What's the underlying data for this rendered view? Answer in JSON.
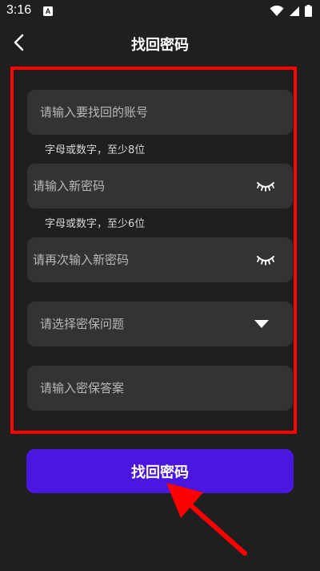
{
  "status_bar": {
    "time": "3:16",
    "notification_glyph": "A",
    "icons": [
      "wifi-icon",
      "signal-icon",
      "battery-icon"
    ]
  },
  "header": {
    "title": "找回密码",
    "back_icon": "chevron-left-icon"
  },
  "form": {
    "account": {
      "placeholder": "请输入要找回的账号",
      "hint": "字母或数字，至少8位"
    },
    "new_password": {
      "placeholder": "请输入新密码",
      "hint": "字母或数字，至少6位",
      "toggle_icon": "eye-closed-icon"
    },
    "confirm_password": {
      "placeholder": "请再次输入新密码",
      "toggle_icon": "eye-closed-icon"
    },
    "security_question": {
      "placeholder": "请选择密保问题",
      "dropdown_icon": "caret-down-icon"
    },
    "security_answer": {
      "placeholder": "请输入密保答案"
    }
  },
  "submit": {
    "label": "找回密码"
  },
  "colors": {
    "background": "#1f1f1f",
    "field": "#333333",
    "primary_button": "#4a17e0",
    "annotation": "#ff0000"
  }
}
